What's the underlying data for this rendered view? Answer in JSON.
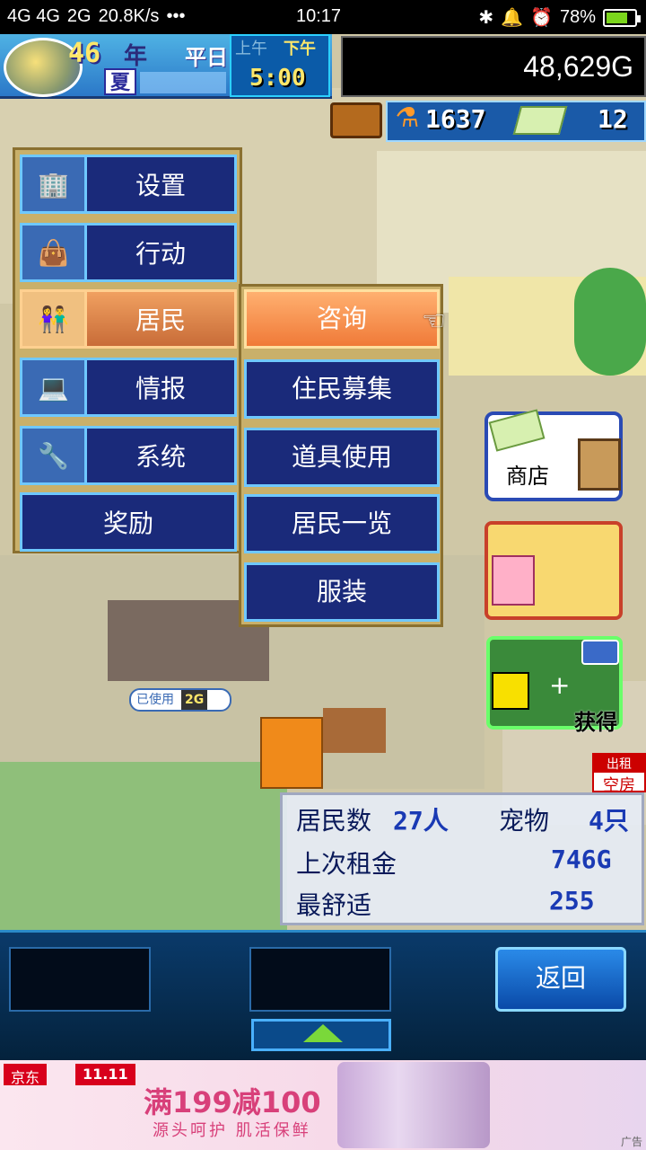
{
  "status_bar": {
    "network": "4G 4G",
    "network2": "2G",
    "speed": "20.8K/s",
    "dots": "•••",
    "time": "10:17",
    "battery": "78%",
    "battery_level": 0.78
  },
  "hud": {
    "year": "46",
    "year_suffix": "年",
    "weekday": "平日",
    "season": "夏",
    "am": "上午",
    "pm": "下午",
    "clock": "5:00",
    "money": "48,629G",
    "research_points": "1637",
    "tickets": "12"
  },
  "menu": {
    "items": [
      {
        "label": "设置",
        "icon": "building-icon"
      },
      {
        "label": "行动",
        "icon": "bag-icon"
      },
      {
        "label": "居民",
        "icon": "residents-icon"
      },
      {
        "label": "情报",
        "icon": "computer-icon"
      },
      {
        "label": "系统",
        "icon": "tools-icon"
      },
      {
        "label": "奖励"
      }
    ],
    "active_index": 2
  },
  "submenu": {
    "items": [
      {
        "label": "咨询"
      },
      {
        "label": "住民募集"
      },
      {
        "label": "道具使用"
      },
      {
        "label": "居民一览"
      },
      {
        "label": "服装"
      }
    ],
    "active_index": 0
  },
  "side_buttons": {
    "shop": "商店",
    "camera": "获得"
  },
  "rent_tag": {
    "line1": "出租",
    "line2": "空房"
  },
  "world_label": {
    "used": "已使用",
    "size": "2G"
  },
  "info_panel": {
    "residents_label": "居民数",
    "residents_value": "27人",
    "pets_label": "宠物",
    "pets_value": "4只",
    "rent_label": "上次租金",
    "rent_value": "746G",
    "comfort_label": "最舒适",
    "comfort_value": "255"
  },
  "bottom": {
    "back": "返回"
  },
  "ad": {
    "brand": "京东",
    "tag": "11.11",
    "headline": "满199减100",
    "subline": "源头呵护  肌活保鲜",
    "ad_mark": "广告"
  }
}
